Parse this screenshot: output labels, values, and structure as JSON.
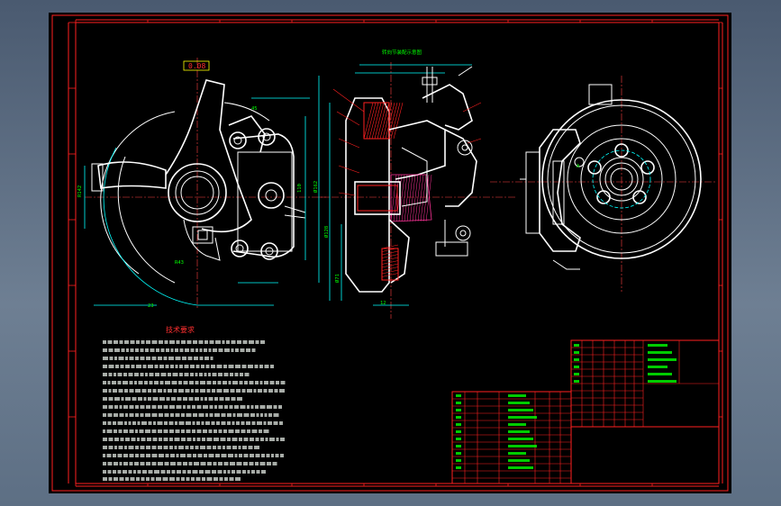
{
  "drawing": {
    "notes_title": "技术要求",
    "section_label": "转向节装配示意图",
    "colors": {
      "frame": "#ff2020",
      "geometry": "#ffffff",
      "dims": "#00ffff",
      "text": "#00ff00",
      "centerline": "#ff4040"
    }
  }
}
